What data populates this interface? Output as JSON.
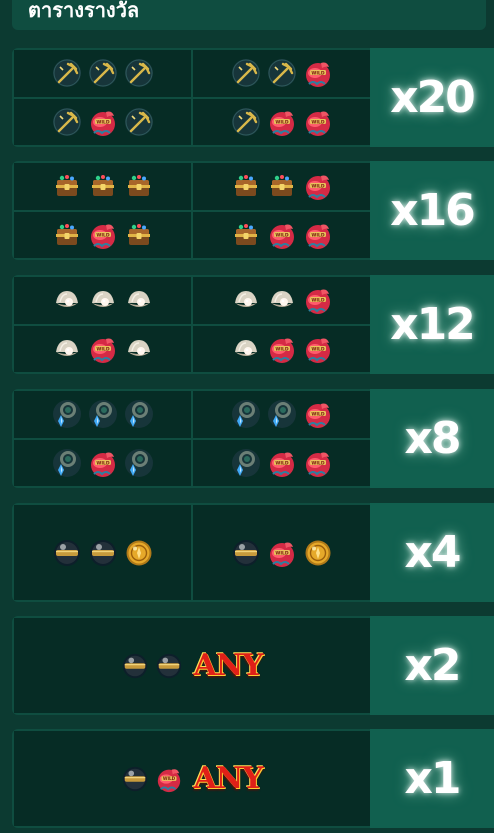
{
  "header": {
    "title": "ตารางรางวัล"
  },
  "colors": {
    "background": "#0c3a31",
    "cell": "#062c25",
    "multiplier_panel": "#11604f",
    "border": "#0f4d40"
  },
  "paytable": [
    {
      "multiplier": "x20",
      "layout": "c4",
      "cells": [
        [
          "trident-icon",
          "trident-icon",
          "trident-icon"
        ],
        [
          "trident-icon",
          "trident-icon",
          "wild-icon"
        ],
        [
          "trident-icon",
          "wild-icon",
          "trident-icon"
        ],
        [
          "trident-icon",
          "wild-icon",
          "wild-icon"
        ]
      ]
    },
    {
      "multiplier": "x16",
      "layout": "c4",
      "cells": [
        [
          "chest-icon",
          "chest-icon",
          "chest-icon"
        ],
        [
          "chest-icon",
          "chest-icon",
          "wild-icon"
        ],
        [
          "chest-icon",
          "wild-icon",
          "chest-icon"
        ],
        [
          "chest-icon",
          "wild-icon",
          "wild-icon"
        ]
      ]
    },
    {
      "multiplier": "x12",
      "layout": "c4",
      "cells": [
        [
          "pearl-icon",
          "pearl-icon",
          "pearl-icon"
        ],
        [
          "pearl-icon",
          "pearl-icon",
          "wild-icon"
        ],
        [
          "pearl-icon",
          "wild-icon",
          "pearl-icon"
        ],
        [
          "pearl-icon",
          "wild-icon",
          "wild-icon"
        ]
      ]
    },
    {
      "multiplier": "x8",
      "layout": "c4",
      "cells": [
        [
          "amulet-icon",
          "amulet-icon",
          "amulet-icon"
        ],
        [
          "amulet-icon",
          "amulet-icon",
          "wild-icon"
        ],
        [
          "amulet-icon",
          "wild-icon",
          "amulet-icon"
        ],
        [
          "amulet-icon",
          "wild-icon",
          "wild-icon"
        ]
      ]
    },
    {
      "multiplier": "x4",
      "layout": "c2",
      "cells": [
        [
          "orb-icon",
          "orb-icon",
          "coin-icon"
        ],
        [
          "orb-icon",
          "wild-icon",
          "coin-icon"
        ]
      ]
    },
    {
      "multiplier": "x2",
      "layout": "c1",
      "cells": [
        [
          "orb-icon",
          "orb-icon",
          "any-label"
        ]
      ]
    },
    {
      "multiplier": "x1",
      "layout": "c1",
      "cells": [
        [
          "orb-icon",
          "wild-icon",
          "any-label"
        ]
      ]
    }
  ],
  "any_label": "ANY"
}
